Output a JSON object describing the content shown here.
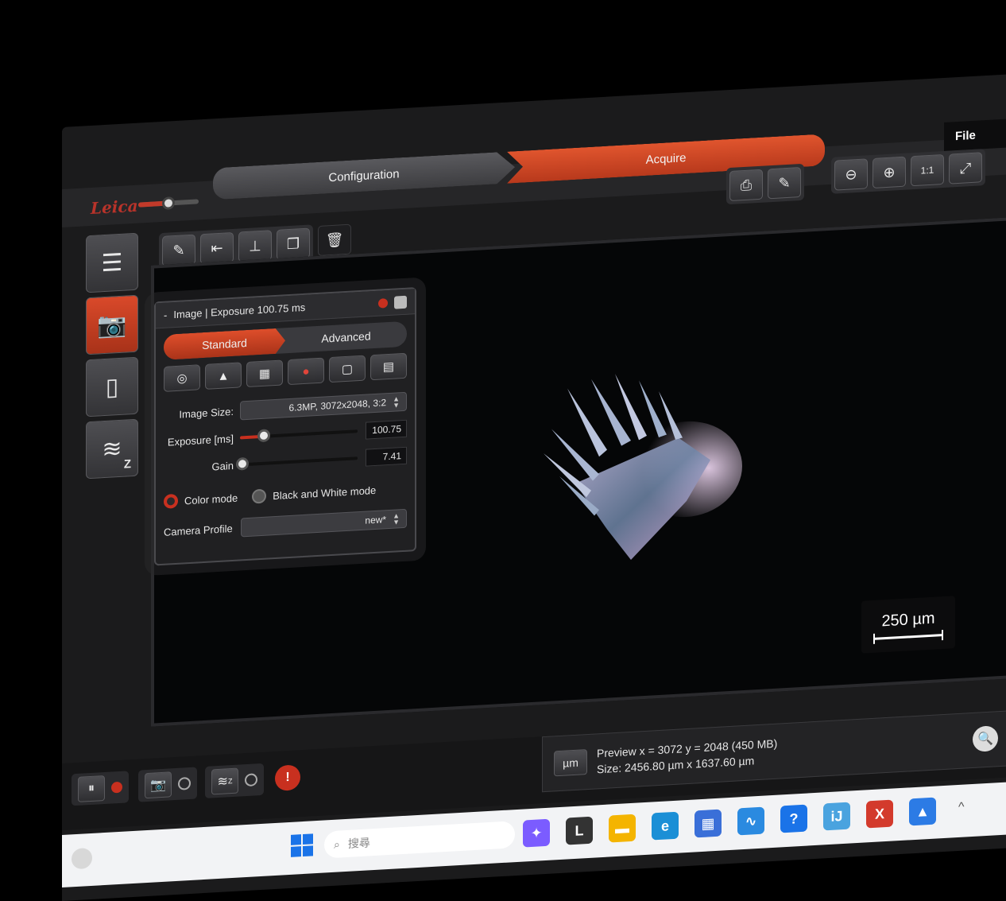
{
  "app": {
    "logo_text": "Leica",
    "steps": {
      "configuration": "Configuration",
      "acquire": "Acquire"
    },
    "file_menu": "File"
  },
  "toolbar": {
    "right_group1": [
      "print-icon",
      "report-icon"
    ],
    "right_group2": [
      "zoom-out-icon",
      "zoom-in-icon",
      "actual-size-icon",
      "fit-screen-icon"
    ],
    "left_group": [
      "annotate-icon",
      "measure-icon",
      "stamp-icon",
      "copy-icon"
    ],
    "trash": "trash-icon",
    "glyphs": {
      "print-icon": "⎙",
      "report-icon": "✎",
      "zoom-out-icon": "⊖",
      "zoom-in-icon": "⊕",
      "actual-size-icon": "1:1",
      "fit-screen-icon": "⤢",
      "annotate-icon": "✎",
      "measure-icon": "⇤",
      "stamp-icon": "⊥",
      "copy-icon": "❐",
      "trash-icon": "🗑"
    }
  },
  "sidebar": {
    "items": [
      {
        "name": "project-icon",
        "glyph": "☰",
        "active": false
      },
      {
        "name": "camera-icon",
        "glyph": "📷",
        "active": true
      },
      {
        "name": "storage-icon",
        "glyph": "▯",
        "active": false
      },
      {
        "name": "z-stack-icon",
        "glyph": "≋",
        "active": false,
        "badge": "Z"
      }
    ]
  },
  "panel": {
    "title": "Image | Exposure 100.75 ms",
    "collapse": "-",
    "tabs": {
      "standard": "Standard",
      "advanced": "Advanced"
    },
    "icon_row": [
      "white-balance-icon",
      "histogram-icon",
      "grid-icon",
      "color-icon",
      "brightness-icon",
      "settings-sheet-icon"
    ],
    "icon_glyphs": [
      "◎",
      "▲",
      "▦",
      "●",
      "▢",
      "▤"
    ],
    "image_size": {
      "label": "Image Size:",
      "value": "6.3MP, 3072x2048, 3:2"
    },
    "exposure": {
      "label": "Exposure [ms]",
      "value": "100.75",
      "fraction": 0.2
    },
    "gain": {
      "label": "Gain",
      "value": "7.41",
      "fraction": 0.02
    },
    "modes": {
      "color": "Color mode",
      "bw": "Black and White mode",
      "selected": "color"
    },
    "camera_profile": {
      "label": "Camera Profile",
      "value": "new*"
    }
  },
  "viewport": {
    "scale_label": "250 µm"
  },
  "bottombar": {
    "pause": "⏸",
    "camera": "📷",
    "zstack": "≋",
    "zstack_badge": "Z",
    "warn": "!",
    "unit_button": "µm",
    "status_line1": "Preview   x = 3072  y = 2048  (450 MB)",
    "status_line2": "Size: 2456.80 µm x 1637.60 µm",
    "zoom_glyph": "🔍"
  },
  "taskbar": {
    "search_placeholder": "搜尋",
    "search_icon": "⌕",
    "apps": [
      {
        "name": "copilot-icon",
        "glyph": "✦",
        "color": "#7b5cff"
      },
      {
        "name": "app-l-icon",
        "glyph": "L",
        "color": "#333333"
      },
      {
        "name": "file-explorer-icon",
        "glyph": "▬",
        "color": "#f4b400"
      },
      {
        "name": "edge-icon",
        "glyph": "e",
        "color": "#1b8fd6"
      },
      {
        "name": "store-icon",
        "glyph": "▦",
        "color": "#3a6fd8"
      },
      {
        "name": "monitor-app-icon",
        "glyph": "∿",
        "color": "#2a8ae0"
      },
      {
        "name": "help-icon",
        "glyph": "?",
        "color": "#1a73e8"
      },
      {
        "name": "imagej-icon",
        "glyph": "iJ",
        "color": "#4aa3df"
      },
      {
        "name": "x-app-icon",
        "glyph": "X",
        "color": "#d33a2c"
      },
      {
        "name": "photos-icon",
        "glyph": "▲",
        "color": "#2c7be5"
      }
    ],
    "tray_chevron": "^"
  }
}
